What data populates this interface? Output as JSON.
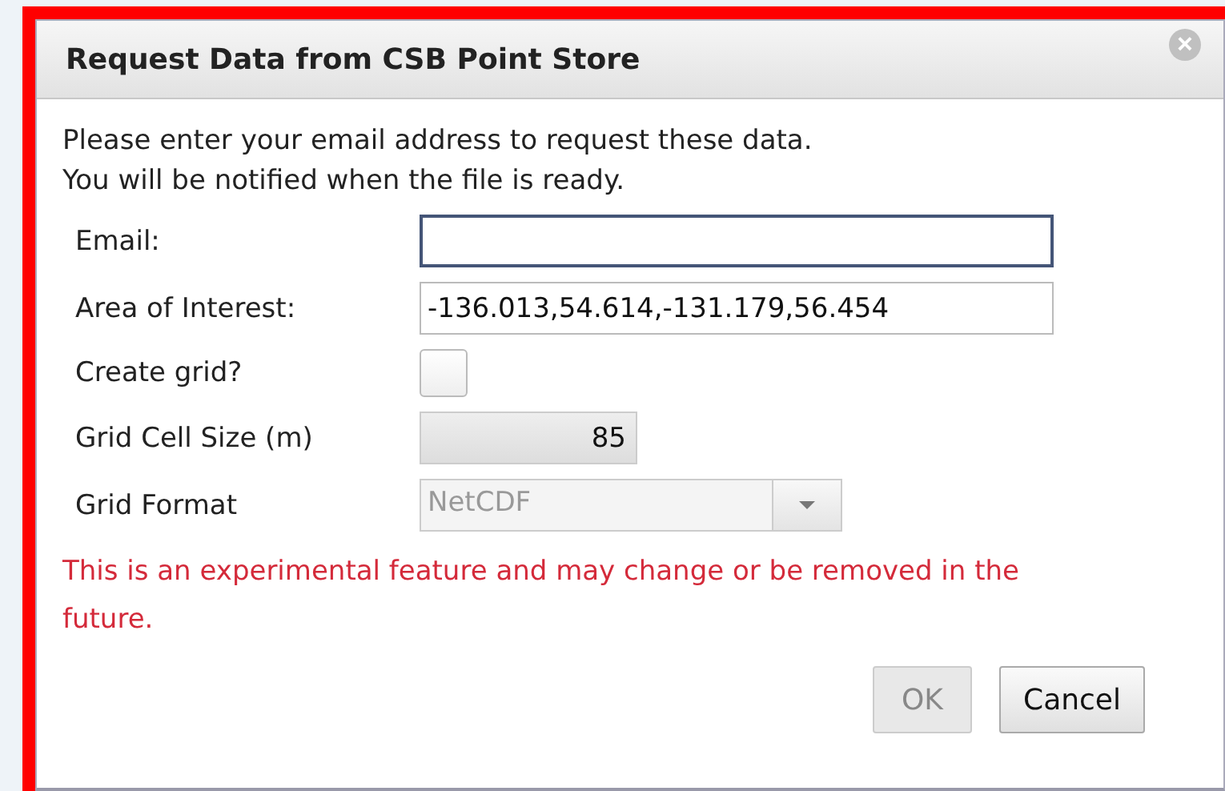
{
  "dialog": {
    "title": "Request Data from CSB Point Store",
    "close": "×",
    "intro": [
      "Please enter your email address to request these data.",
      "You will be notified when the file is ready."
    ],
    "fields": [
      {
        "kind": "text",
        "label": "Email:",
        "focused": true,
        "disabled": false
      },
      {
        "kind": "text",
        "label": "Area of Interest:",
        "value": "-136.013,54.614,-131.179,56.454",
        "focused": false,
        "disabled": false
      },
      {
        "kind": "checkbox",
        "label": "Create grid?",
        "checked": false
      },
      {
        "kind": "number",
        "label": "Grid Cell Size (m)",
        "value": "85",
        "disabled": true
      },
      {
        "kind": "select",
        "label": "Grid Format",
        "value": "NetCDF",
        "disabled": true
      }
    ],
    "warning": "This is an experimental feature and may change or be removed in the future.",
    "buttons": [
      {
        "label": "OK",
        "disabled": true
      },
      {
        "label": "Cancel",
        "disabled": false
      }
    ]
  }
}
